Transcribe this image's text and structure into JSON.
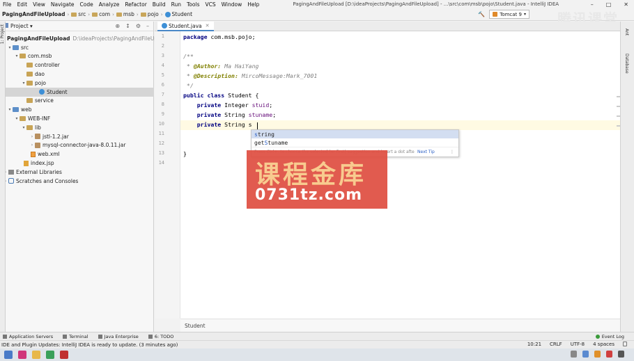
{
  "menu": [
    "File",
    "Edit",
    "View",
    "Navigate",
    "Code",
    "Analyze",
    "Refactor",
    "Build",
    "Run",
    "Tools",
    "VCS",
    "Window",
    "Help"
  ],
  "window_title": "PagingAndFileUpload [D:\\ideaProjects\\PagingAndFileUpload] - ...\\src\\com\\msb\\pojo\\Student.java - IntelliJ IDEA",
  "window_controls": [
    "–",
    "□",
    "✕"
  ],
  "nav": {
    "crumbs": [
      "PagingAndFileUpload",
      "src",
      "com",
      "msb",
      "pojo",
      "Student"
    ],
    "run_config": "Tomcat 9",
    "hammer": "🔨"
  },
  "brand_watermark": "腾讯课堂",
  "left_strip_label": "1: Project",
  "project": {
    "header": "Project",
    "tools": [
      "⊕",
      "↕",
      "⚙",
      "–"
    ],
    "tree": [
      {
        "label": "PagingAndFileUpload",
        "extra": "D:\\ideaProjects\\PagingAndFileUp",
        "bold": true
      },
      {
        "label": "src",
        "extra": ""
      },
      {
        "label": "com.msb",
        "extra": ""
      },
      {
        "label": "controller",
        "extra": ""
      },
      {
        "label": "dao",
        "extra": ""
      },
      {
        "label": "pojo",
        "extra": ""
      },
      {
        "label": "Student",
        "extra": ""
      },
      {
        "label": "service",
        "extra": ""
      },
      {
        "label": "web",
        "extra": ""
      },
      {
        "label": "WEB-INF",
        "extra": ""
      },
      {
        "label": "lib",
        "extra": ""
      },
      {
        "label": "jstl-1.2.jar",
        "extra": ""
      },
      {
        "label": "mysql-connector-java-8.0.11.jar",
        "extra": ""
      },
      {
        "label": "web.xml",
        "extra": ""
      },
      {
        "label": "index.jsp",
        "extra": ""
      },
      {
        "label": "External Libraries",
        "extra": ""
      },
      {
        "label": "Scratches and Consoles",
        "extra": ""
      }
    ]
  },
  "editor": {
    "tab": "Student.java",
    "tab_close": "✕",
    "line_numbers": [
      "1",
      "2",
      "3",
      "4",
      "5",
      "6",
      "7",
      "8",
      "9",
      "10",
      "11",
      "12",
      "13",
      "14"
    ],
    "code": {
      "l1_kw": "package",
      "l1_rest": " com.msb.pojo;",
      "l3": "/**",
      "l4_pre": " * ",
      "l4_ann": "@Author:",
      "l4_rest": " Ma HaiYang",
      "l5_pre": " * ",
      "l5_ann": "@Description:",
      "l5_rest": " MircoMessage:Mark_7001",
      "l6": " */",
      "l7_kw": "public class",
      "l7_rest": " Student {",
      "l8_kw": "    private",
      "l8_type": " Integer ",
      "l8_field": "stuid",
      "l8_end": ";",
      "l9_kw": "    private",
      "l9_type": " String ",
      "l9_field": "stuname",
      "l9_end": ";",
      "l10_kw": "    private",
      "l10_type": " String ",
      "l10_typed": "s",
      "l13": "}"
    },
    "breadcrumb": "Student"
  },
  "completion": {
    "items": [
      {
        "hl": "s",
        "rest": "tring"
      },
      {
        "pre": "get",
        "hl": "S",
        "rest": "tuname"
      }
    ],
    "footer": "Press Ctrl+. to choose the selected (or first) suggestion and insert a dot afterwards",
    "footer_tip": "Next Tip",
    "footer_menu": "⋮"
  },
  "promo": {
    "line1": "课程金库",
    "line2": "0731tz.com"
  },
  "right_strip_labels": [
    "Ant",
    "Database"
  ],
  "toolwindows": [
    "Application Servers",
    "Terminal",
    "Java Enterprise",
    "6: TODO"
  ],
  "event_log": "Event Log",
  "status": {
    "message": "IDE and Plugin Updates: IntelliJ IDEA is ready to update. (3 minutes ago)",
    "position": "10:21",
    "line_sep": "CRLF",
    "encoding": "UTF-8",
    "indent": "4 spaces"
  }
}
